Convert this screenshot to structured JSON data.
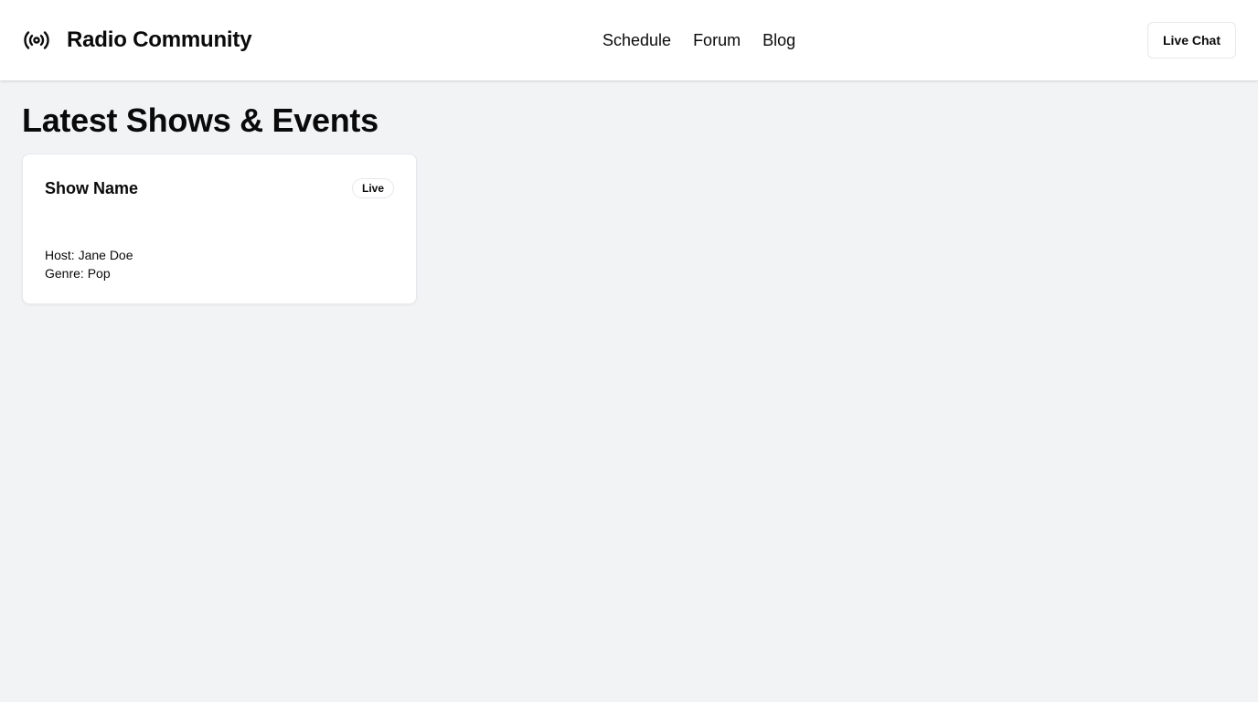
{
  "header": {
    "brand_icon": "radio-broadcast-icon",
    "brand_title": "Radio Community",
    "nav": [
      {
        "label": "Schedule"
      },
      {
        "label": "Forum"
      },
      {
        "label": "Blog"
      }
    ],
    "live_chat_label": "Live Chat"
  },
  "main": {
    "title": "Latest Shows & Events",
    "cards": [
      {
        "title": "Show Name",
        "badge": "Live",
        "host": "Host: Jane Doe",
        "genre": "Genre: Pop"
      }
    ]
  },
  "colors": {
    "background": "#f2f3f5",
    "surface": "#ffffff",
    "border": "#e5e7eb",
    "text": "#0a0a0a"
  }
}
